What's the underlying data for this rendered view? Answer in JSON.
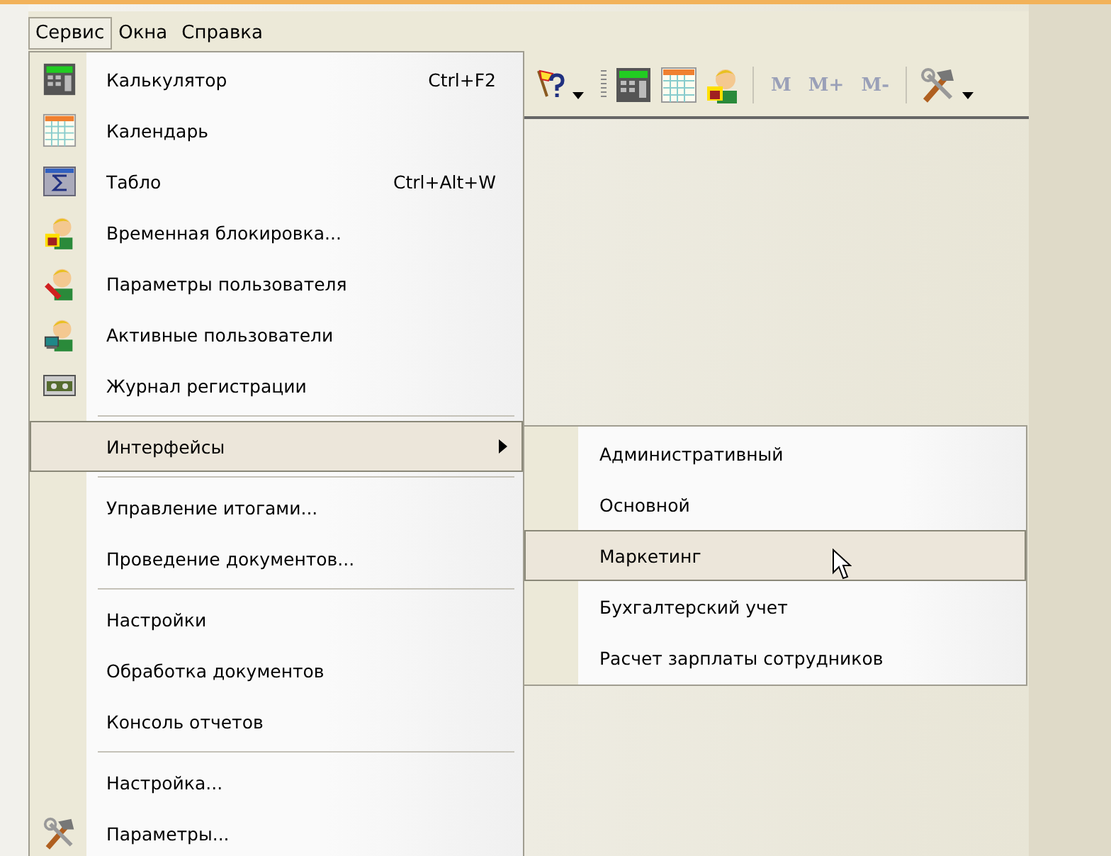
{
  "menubar": [
    {
      "label": "Сервис",
      "selected": true
    },
    {
      "label": "Окна",
      "selected": false
    },
    {
      "label": "Справка",
      "selected": false
    }
  ],
  "toolbar": {
    "memory_buttons": [
      {
        "label": "M",
        "disabled": true
      },
      {
        "label": "M+",
        "disabled": true
      },
      {
        "label": "M-",
        "disabled": true
      }
    ]
  },
  "menu": {
    "items": [
      {
        "kind": "item",
        "label": "Калькулятор",
        "shortcut": "Ctrl+F2",
        "selected": false
      },
      {
        "kind": "item",
        "label": "Календарь",
        "selected": false
      },
      {
        "kind": "item",
        "label": "Табло",
        "shortcut": "Ctrl+Alt+W",
        "selected": false
      },
      {
        "kind": "item",
        "label": "Временная блокировка...",
        "selected": false
      },
      {
        "kind": "item",
        "label": "Параметры пользователя",
        "selected": false
      },
      {
        "kind": "item",
        "label": "Активные пользователи",
        "selected": false
      },
      {
        "kind": "item",
        "label": "Журнал регистрации",
        "selected": false
      },
      {
        "kind": "separator"
      },
      {
        "kind": "submenu",
        "label": "Интерфейсы",
        "selected": true
      },
      {
        "kind": "separator"
      },
      {
        "kind": "item",
        "label": "Управление итогами...",
        "selected": false
      },
      {
        "kind": "item",
        "label": "Проведение документов...",
        "selected": false
      },
      {
        "kind": "separator"
      },
      {
        "kind": "item",
        "label": "Настройки",
        "selected": false
      },
      {
        "kind": "item",
        "label": "Обработка документов",
        "selected": false
      },
      {
        "kind": "item",
        "label": "Консоль отчетов",
        "selected": false
      },
      {
        "kind": "separator"
      },
      {
        "kind": "item",
        "label": "Настройка...",
        "selected": false
      },
      {
        "kind": "item",
        "label": "Параметры...",
        "selected": false
      }
    ]
  },
  "submenu": {
    "items": [
      {
        "label": "Административный",
        "selected": false
      },
      {
        "label": "Основной",
        "selected": false
      },
      {
        "label": "Маркетинг",
        "selected": true
      },
      {
        "label": "Бухгалтерский учет",
        "selected": false
      },
      {
        "label": "Расчет зарплаты сотрудников",
        "selected": false
      }
    ]
  }
}
